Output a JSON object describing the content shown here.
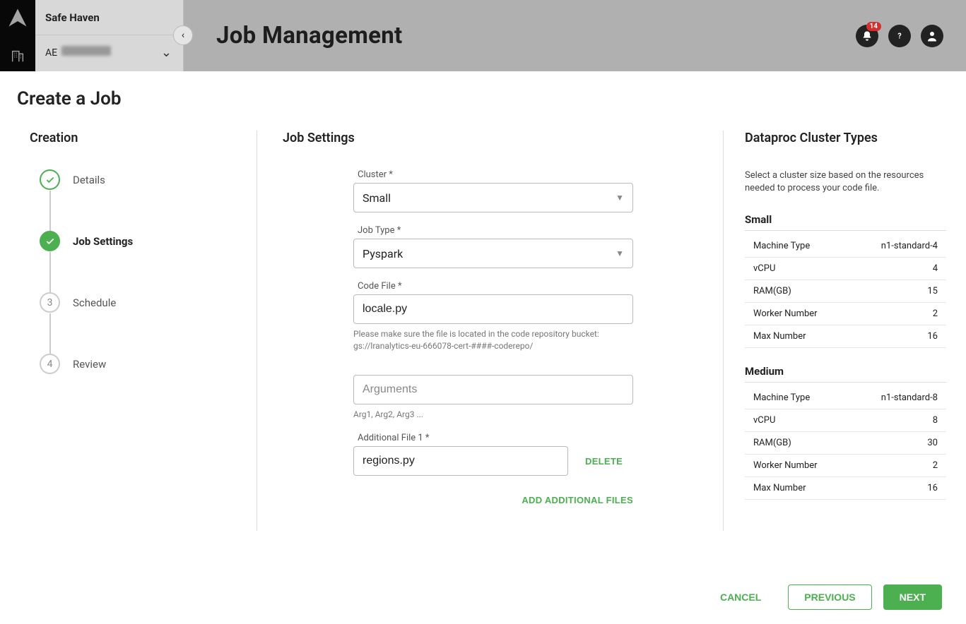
{
  "brand": {
    "name": "Safe Haven",
    "account_prefix": "AE"
  },
  "header": {
    "page_title": "Job Management",
    "notif_count": "14"
  },
  "content": {
    "title": "Create a Job"
  },
  "stepper": {
    "title": "Creation",
    "steps": [
      {
        "label": "Details",
        "state": "done",
        "num": "✓"
      },
      {
        "label": "Job Settings",
        "state": "active",
        "num": "✓"
      },
      {
        "label": "Schedule",
        "state": "pending",
        "num": "3"
      },
      {
        "label": "Review",
        "state": "pending",
        "num": "4"
      }
    ]
  },
  "form": {
    "title": "Job Settings",
    "cluster_label": "Cluster *",
    "cluster_value": "Small",
    "jobtype_label": "Job Type *",
    "jobtype_value": "Pyspark",
    "codefile_label": "Code File *",
    "codefile_value": "locale.py",
    "codefile_hint": "Please make sure the file is located in the code repository bucket: gs://lranalytics-eu-666078-cert-####-coderepo/",
    "args_placeholder": "Arguments",
    "args_hint": "Arg1, Arg2, Arg3 ...",
    "addfile_label": "Additional File 1 *",
    "addfile_value": "regions.py",
    "delete_label": "DELETE",
    "add_label": "ADD ADDITIONAL FILES"
  },
  "info": {
    "title": "Dataproc Cluster Types",
    "desc": "Select a cluster size based on the resources needed to process your code file.",
    "types": [
      {
        "name": "Small",
        "rows": [
          {
            "k": "Machine Type",
            "v": "n1-standard-4"
          },
          {
            "k": "vCPU",
            "v": "4"
          },
          {
            "k": "RAM(GB)",
            "v": "15"
          },
          {
            "k": "Worker Number",
            "v": "2"
          },
          {
            "k": "Max Number",
            "v": "16"
          }
        ]
      },
      {
        "name": "Medium",
        "rows": [
          {
            "k": "Machine Type",
            "v": "n1-standard-8"
          },
          {
            "k": "vCPU",
            "v": "8"
          },
          {
            "k": "RAM(GB)",
            "v": "30"
          },
          {
            "k": "Worker Number",
            "v": "2"
          },
          {
            "k": "Max Number",
            "v": "16"
          }
        ]
      }
    ]
  },
  "footer": {
    "cancel": "CANCEL",
    "previous": "PREVIOUS",
    "next": "NEXT"
  }
}
